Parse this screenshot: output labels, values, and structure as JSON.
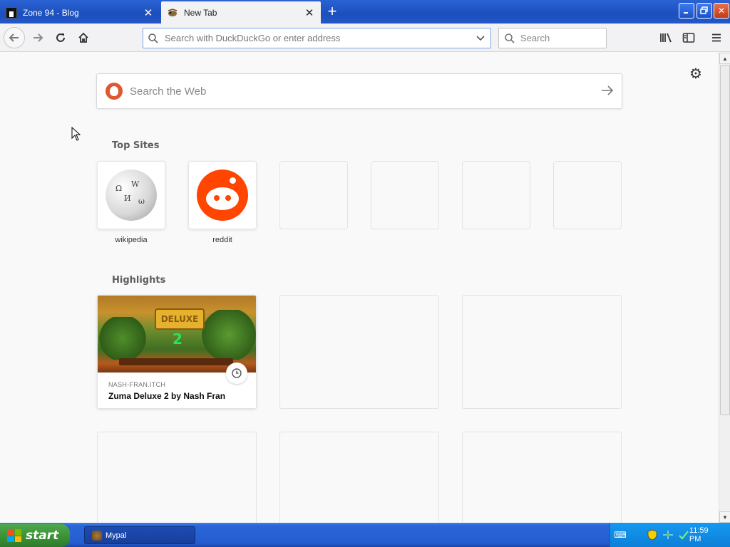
{
  "tabs": [
    {
      "title": "Zone 94 - Blog",
      "active": false
    },
    {
      "title": "New Tab",
      "active": true
    }
  ],
  "toolbar": {
    "urlbar_placeholder": "Search with DuckDuckGo or enter address",
    "search_placeholder": "Search"
  },
  "newtab": {
    "web_search_placeholder": "Search the Web",
    "top_sites_title": "Top Sites",
    "top_sites": [
      {
        "label": "wikipedia",
        "icon": "wikipedia-globe-icon"
      },
      {
        "label": "reddit",
        "icon": "reddit-alien-icon"
      },
      {
        "label": ""
      },
      {
        "label": ""
      },
      {
        "label": ""
      },
      {
        "label": ""
      }
    ],
    "highlights_title": "Highlights",
    "highlights": [
      {
        "source": "NASH-FRAN.ITCH",
        "title": "Zuma Deluxe 2 by Nash Fran",
        "thumbnail_text": "DELUXE",
        "thumbnail_number": "2"
      }
    ]
  },
  "taskbar": {
    "start_label": "start",
    "tasks": [
      {
        "label": "Mypal"
      }
    ],
    "clock": "11:59 PM"
  },
  "colors": {
    "titlebar": "#1c4fbd",
    "reddit": "#ff4500",
    "duckduckgo": "#de5833",
    "start_button": "#3a8f35"
  }
}
